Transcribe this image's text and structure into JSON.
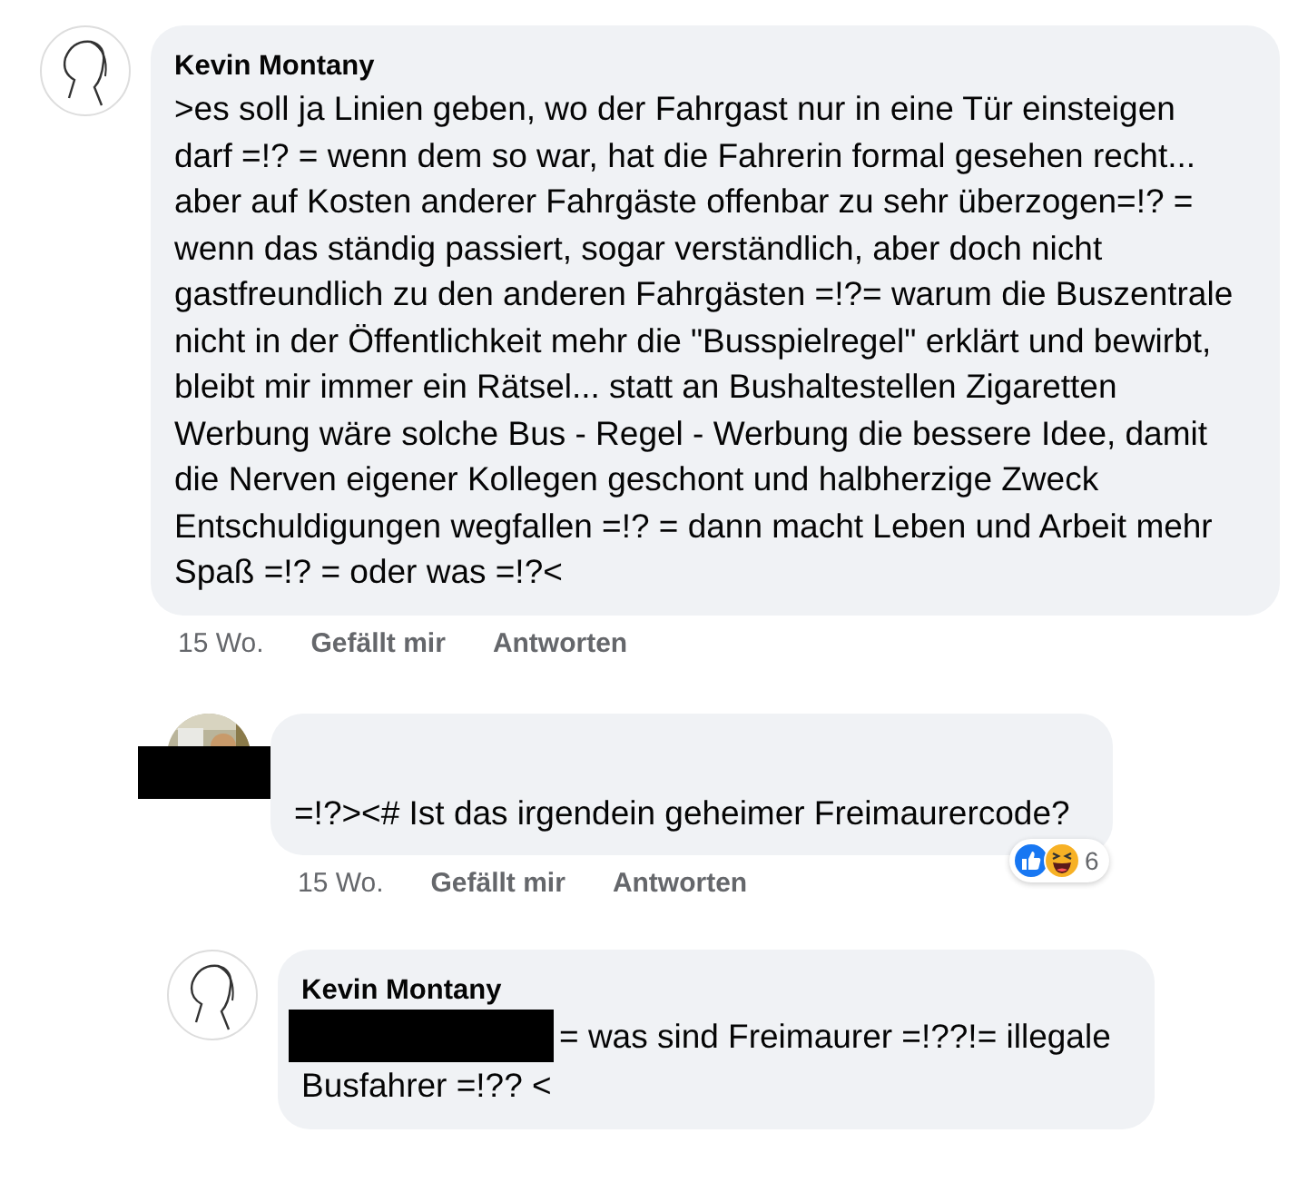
{
  "comments": [
    {
      "author": "Kevin Montany",
      "author_redacted": false,
      "text_redacted_prefix": false,
      "text": ">es  soll ja Linien geben, wo der Fahrgast nur in eine Tür einsteigen darf =!? = wenn dem so war, hat die Fahrerin formal gesehen recht... aber auf Kosten anderer Fahrgäste offenbar zu sehr überzogen=!? = wenn das ständig passiert, sogar verständlich, aber doch nicht gastfreundlich zu den anderen Fahrgästen =!?= warum  die Buszentrale nicht in der Öffentlichkeit mehr die \"Busspielregel\" erklärt und bewirbt, bleibt mir immer ein Rätsel... statt an Bushaltestellen Zigaretten Werbung wäre solche Bus - Regel - Werbung die bessere Idee, damit die Nerven eigener Kollegen geschont und halbherzige Zweck Entschuldigungen wegfallen =!? = dann macht Leben und Arbeit mehr Spaß =!? = oder was =!?<",
      "time": "15 Wo.",
      "actions": [
        "Gefällt mir",
        "Antworten"
      ],
      "replies": [
        {
          "author_redacted": true,
          "text_redacted_prefix": false,
          "text": "=!?><# Ist das irgendein geheimer Freimaurercode?",
          "time": "15 Wo.",
          "actions": [
            "Gefällt mir",
            "Antworten"
          ],
          "reactions": {
            "count": "6"
          }
        },
        {
          "author": "Kevin Montany",
          "author_redacted": false,
          "text_redacted_prefix": true,
          "lines": [
            "= was sind Freimaurer =!??!= illegale",
            "Busfahrer =!?? <"
          ]
        }
      ]
    }
  ]
}
